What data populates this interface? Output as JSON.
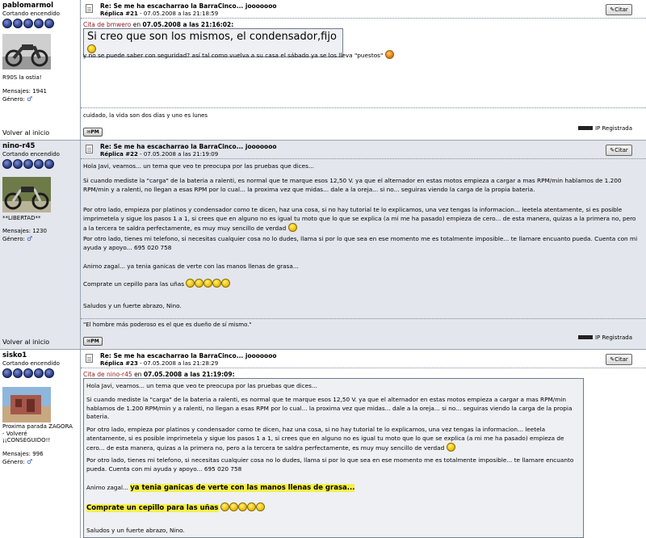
{
  "posts": [
    {
      "username": "pablomarmol",
      "user_title": "Cortando encendido",
      "avatar_caption": "R90S la ostia!",
      "stats_mensajes": "Mensajes: 1941",
      "stats_genero": "Género:",
      "volver": "Volver al inicio",
      "subject": "Re: Se me ha escacharrao la BarraCinco... jooooooo",
      "reply_label": "Réplica #21",
      "reply_date": " - 07.05.2008 a las 21:18:59",
      "citar": "Citar",
      "quote_prefix": "Cita de",
      "quote_author": "bmwero",
      "quote_on": "en",
      "quote_date": "07.05.2008 a las 21:16:02:",
      "quote_text": "Si creo que son los mismos, el condensador,fijo",
      "body": [
        "y no se puede saber con seguridad? así tal como vuelva a su casa el sábado ya se los lleva \"puestos\""
      ],
      "signature": "cuidado, la vida son dos días y uno es lunes",
      "pm": "PM",
      "ip": "IP Registrada"
    },
    {
      "username": "nino-r45",
      "user_title": "Cortando encendido",
      "avatar_caption": "**LIBERTAD**",
      "stats_mensajes": "Mensajes: 1230",
      "stats_genero": "Género:",
      "volver": "Volver al inicio",
      "subject": "Re: Se me ha escacharrao la BarraCinco... jooooooo",
      "reply_label": "Réplica #22",
      "reply_date": " - 07.05.2008 a las 21:19:09",
      "citar": "Citar",
      "body": [
        "Hola Javi, veamos... un tema que veo te preocupa por las pruebas que dices...",
        "Si cuando mediste la \"carga\" de la bateria a ralenti, es normal que te marque esos 12,50 V. ya que el alternador en estas motos empieza a cargar a mas RPM/min hablamos de 1.200 RPM/min y a ralenti, no llegan a esas RPM por lo cual... la proxima vez que midas... dale a la oreja... si no... seguiras viendo la carga de la propia bateria.",
        "Por otro lado, empieza por platinos y condensador como te dicen, haz una cosa, si no hay tutorial te lo explicamos, una vez tengas la informacion... leetela atentamente, si es posible imprimetela y sigue los pasos 1 a 1, si crees que en alguno no es igual tu moto que lo que se explica (a mi me ha pasado) empieza de cero... de esta manera, quizas a la primera no, pero a la tercera te saldra perfectamente, es muy muy sencillo de verdad",
        "Por otro lado, tienes mi telefono, si necesitas cualquier cosa no lo dudes, llama si por lo que sea en ese momento me es totalmente imposible... te llamare encuanto pueda. Cuenta con mi ayuda y apoyo... 695 020 758",
        "Animo zagal... ya tenia ganicas de verte con las manos llenas de grasa...",
        "Comprate un cepillo para las uñas",
        "Saludos y un fuerte abrazo, Nino."
      ],
      "signature": "\"El hombre más poderoso es el que es dueño de sí mismo.\"",
      "pm": "PM",
      "ip": "IP Registrada"
    },
    {
      "username": "sisko1",
      "user_title": "Cortando encendido",
      "avatar_caption": "Proxima parada ZAGORA - Volveré ¡¡CONSEGUIDO!!",
      "stats_mensajes": "Mensajes: 996",
      "stats_genero": "Género:",
      "subject": "Re: Se me ha escacharrao la BarraCinco... jooooooo",
      "reply_label": "Réplica #23",
      "reply_date": " - 07.05.2008 a las 21:28:29",
      "citar": "Citar",
      "quote_prefix": "Cita de",
      "quote_author": "nino-r45",
      "quote_on": "en",
      "quote_date": "07.05.2008 a las 21:19:09:",
      "quote_body": [
        "Hola Javi, veamos... un tema que veo te preocupa por las pruebas que dices...",
        "Si cuando mediste la \"carga\" de la bateria a ralenti, es normal que te marque esos 12,50 V. ya que el alternador en estas motos empieza a cargar a mas RPM/min hablamos de 1.200 RPM/min y a ralenti, no llegan a esas RPM por lo cual... la proxima vez que midas... dale a la oreja... si no... seguiras viendo la carga de la propia bateria.",
        "Por otro lado, empieza por platinos y condensador como te dicen, haz una cosa, si no hay tutorial te lo explicamos, una vez tengas la informacion... leetela atentamente, si es posible imprimetela y sigue los pasos 1 a 1, si crees que en alguno no es igual tu moto que lo que se explica (a mi me ha pasado) empieza de cero... de esta manera, quizas a la primera no, pero a la tercera te saldra perfectamente, es muy muy sencillo de verdad",
        "Por otro lado, tienes mi telefono, si necesitas cualquier cosa no lo dudes, llama si por lo que sea en ese momento me es totalmente imposible... te llamare encuanto pueda. Cuenta con mi ayuda y apoyo... 695 020 758",
        "Animo zagal...",
        "ya tenia ganicas de verte con las manos llenas de grasa...",
        "Comprate un cepillo para las uñas",
        "Saludos y un fuerte abrazo, Nino."
      ]
    }
  ]
}
